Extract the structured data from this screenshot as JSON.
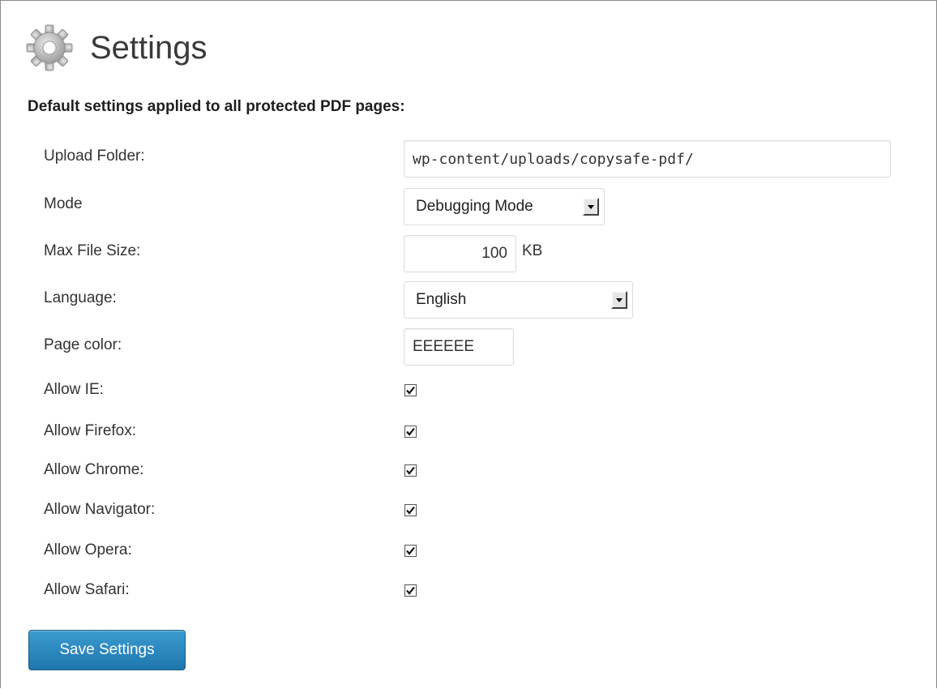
{
  "page": {
    "title": "Settings",
    "subtitle": "Default settings applied to all protected PDF pages:"
  },
  "fields": {
    "upload_folder": {
      "label": "Upload Folder:",
      "value": "wp-content/uploads/copysafe-pdf/"
    },
    "mode": {
      "label": "Mode",
      "value": "Debugging Mode"
    },
    "max_file_size": {
      "label": "Max File Size:",
      "value": "100",
      "unit": "KB"
    },
    "language": {
      "label": "Language:",
      "value": "English"
    },
    "page_color": {
      "label": "Page color:",
      "value": "EEEEEE"
    }
  },
  "browsers": [
    {
      "label": "Allow IE:",
      "checked": true
    },
    {
      "label": "Allow Firefox:",
      "checked": true
    },
    {
      "label": "Allow Chrome:",
      "checked": true
    },
    {
      "label": "Allow Navigator:",
      "checked": true
    },
    {
      "label": "Allow Opera:",
      "checked": true
    },
    {
      "label": "Allow Safari:",
      "checked": true
    }
  ],
  "save_button": {
    "label": "Save Settings"
  },
  "colors": {
    "button_primary": "#2585bd",
    "page_background": "#ffffff"
  },
  "icons": {
    "header": "gear-icon",
    "checkbox": "checkmark-icon"
  }
}
